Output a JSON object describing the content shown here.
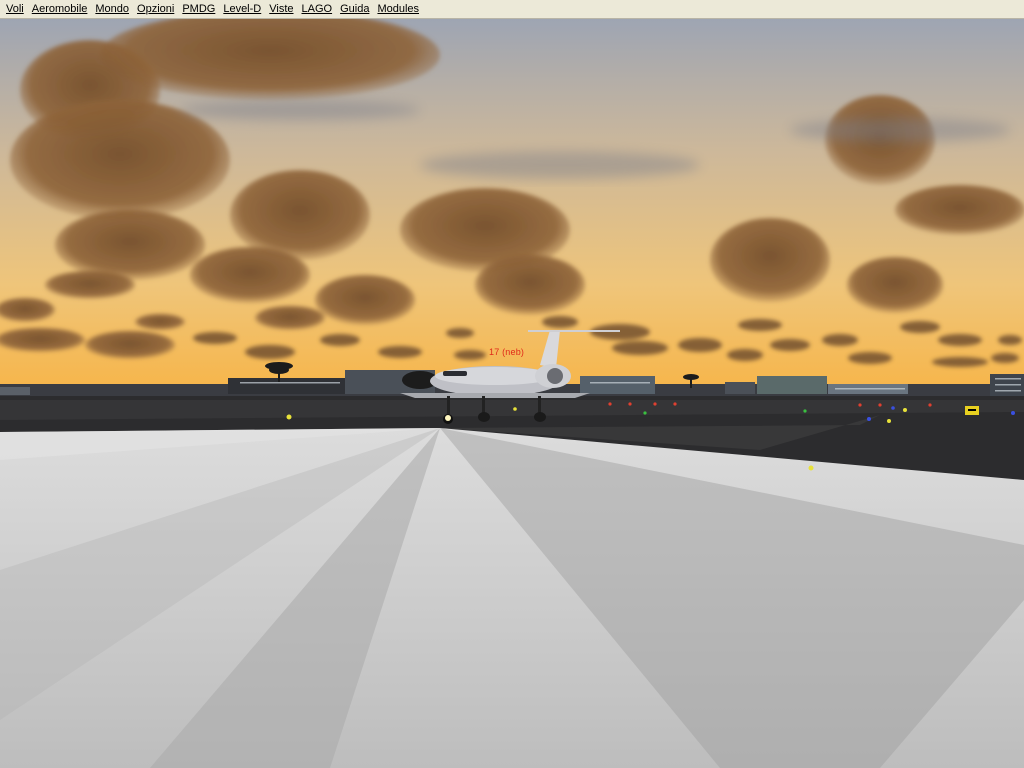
{
  "menu": {
    "items": [
      {
        "label": "Voli"
      },
      {
        "label": "Aeromobile"
      },
      {
        "label": "Mondo"
      },
      {
        "label": "Opzioni"
      },
      {
        "label": "PMDG"
      },
      {
        "label": "Level-D"
      },
      {
        "label": "Viste"
      },
      {
        "label": "LAGO"
      },
      {
        "label": "Guida"
      },
      {
        "label": "Modules"
      }
    ]
  },
  "scene": {
    "aircraft_label": "17 (neb)",
    "sky_colors": {
      "top": "#9aa3b4",
      "mid": "#e6c28c",
      "horizon": "#f6b64a"
    },
    "cloud_color": "#8a5f35",
    "tarmac_color": "#c9c9c9",
    "runway_color": "#2b2b2d",
    "icons": [
      "jet-aircraft-icon",
      "palm-tree-icon",
      "taxiway-sign-icon"
    ]
  }
}
